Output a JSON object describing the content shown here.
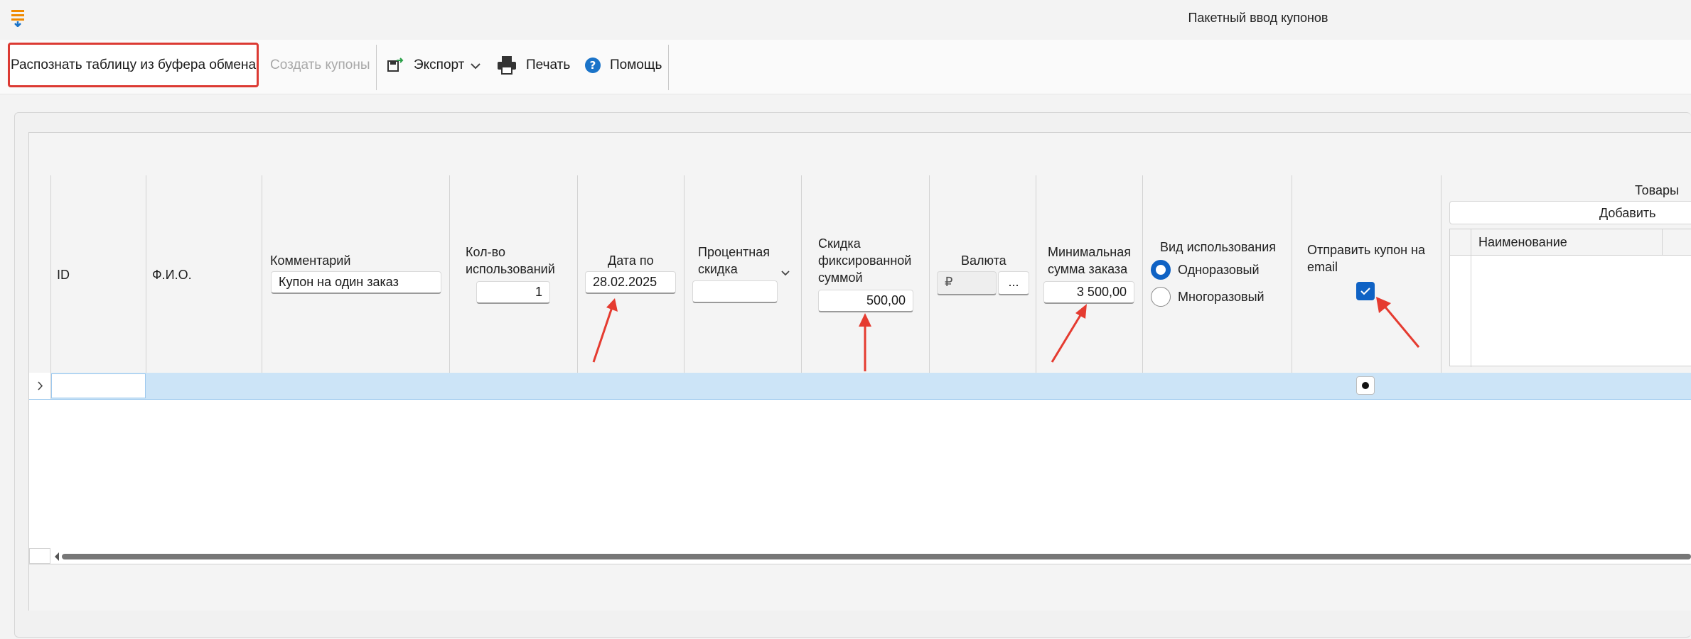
{
  "window": {
    "title": "Пакетный ввод купонов"
  },
  "toolbar": {
    "recognize_label": "Распознать таблицу из буфера обмена",
    "create_label": "Создать купоны",
    "export_label": "Экспорт",
    "print_label": "Печать",
    "help_label": "Помощь"
  },
  "columns": {
    "id": "ID",
    "fio": "Ф.И.О.",
    "comment": "Комментарий",
    "uses": "Кол-во использований",
    "date": "Дата по",
    "percent": "Процентная скидка",
    "fixed": "Скидка фиксированной суммой",
    "currency": "Валюта",
    "min_sum": "Минимальная сумма заказа",
    "usage_type": "Вид использования",
    "send_email": "Отправить купон на email",
    "goods": "Товары",
    "goods_add": "Добавить",
    "goods_name": "Наименование"
  },
  "filters": {
    "comment_value": "Купон на один заказ",
    "uses_value": "1",
    "date_value": "28.02.2025",
    "percent_value": "",
    "fixed_value": "500,00",
    "currency_value": "₽",
    "currency_button": "...",
    "min_sum_value": "3 500,00",
    "usage_single": "Одноразовый",
    "usage_multi": "Многоразовый",
    "usage_selected": "Одноразовый",
    "send_email_checked": true
  },
  "colors": {
    "accent": "#0f62c4",
    "selection": "#cce4f7",
    "highlight_border": "#dc3a33",
    "annotation_arrow": "#e53b30"
  }
}
